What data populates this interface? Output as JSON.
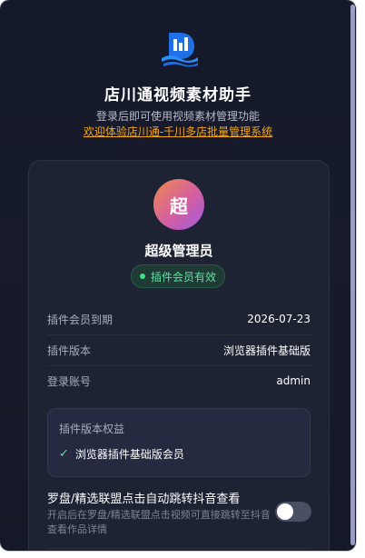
{
  "header": {
    "title": "店川通视频素材助手",
    "subtitle": "登录后即可使用视频素材管理功能",
    "promo_link": "欢迎体验店川通-千川多店批量管理系统"
  },
  "profile": {
    "avatar_text": "超",
    "name": "超级管理员",
    "status": "插件会员有效"
  },
  "info": {
    "expiry_label": "插件会员到期",
    "expiry_value": "2026-07-23",
    "version_label": "插件版本",
    "version_value": "浏览器插件基础版",
    "account_label": "登录账号",
    "account_value": "admin"
  },
  "benefits": {
    "title": "插件版本权益",
    "items": [
      "浏览器插件基础版会员"
    ]
  },
  "feature": {
    "title": "罗盘/精选联盟点击自动跳转抖音查看",
    "description": "开启后在罗盘/精选联盟点击视频可直接跳转至抖音查看作品详情",
    "toggle_on": false
  },
  "colors": {
    "background": "#151a29",
    "card": "#1e2333",
    "accent_link": "#f2a51c",
    "status_green": "#3ee08a",
    "logo_blue": "#1f6fe6"
  },
  "icons": [
    "app-logo-icon",
    "status-dot-icon",
    "check-icon"
  ]
}
